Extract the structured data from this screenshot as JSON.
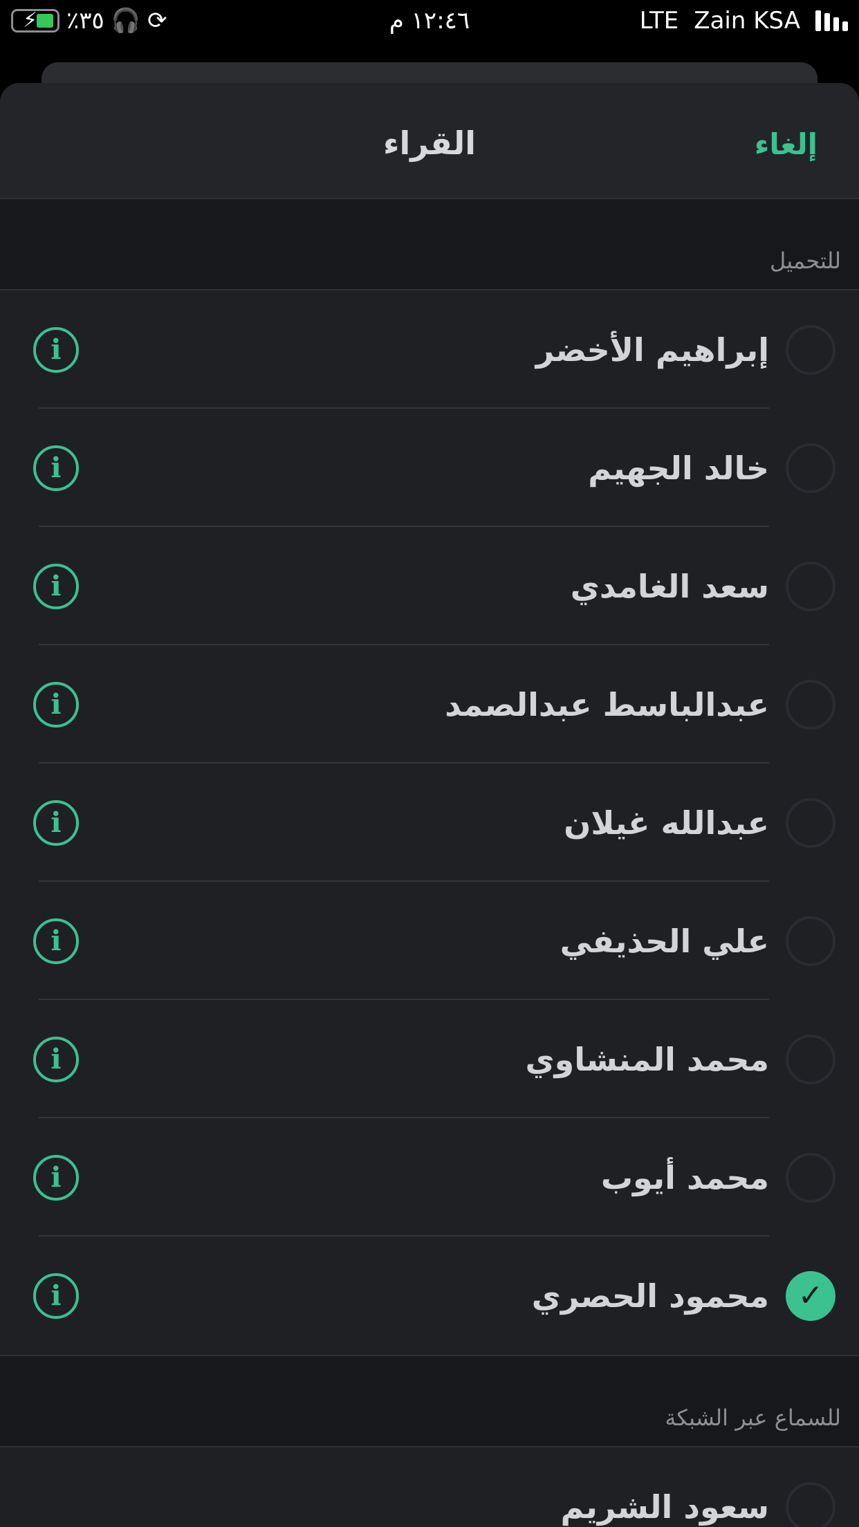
{
  "status_bar": {
    "battery": "٪٣٥",
    "time": "١٢:٤٦ م",
    "network": "LTE",
    "carrier": "Zain KSA"
  },
  "nav": {
    "title": "القراء",
    "cancel": "إلغاء"
  },
  "sections": [
    {
      "header": "للتحميل",
      "items": [
        {
          "name": "إبراهيم الأخضر",
          "checked": false
        },
        {
          "name": "خالد الجهيم",
          "checked": false
        },
        {
          "name": "سعد الغامدي",
          "checked": false
        },
        {
          "name": "عبدالباسط عبدالصمد",
          "checked": false
        },
        {
          "name": "عبدالله غيلان",
          "checked": false
        },
        {
          "name": "علي الحذيفي",
          "checked": false
        },
        {
          "name": "محمد المنشاوي",
          "checked": false
        },
        {
          "name": "محمد أيوب",
          "checked": false
        },
        {
          "name": "محمود الحصري",
          "checked": true
        }
      ]
    },
    {
      "header": "للسماع عبر الشبكة",
      "items": [
        {
          "name": "سعود الشريم",
          "checked": false
        }
      ]
    }
  ],
  "icons": {
    "info": "i",
    "check": "✓"
  },
  "colors": {
    "accent": "#3cc190",
    "background": "#17181b",
    "cell": "#1e2024"
  }
}
